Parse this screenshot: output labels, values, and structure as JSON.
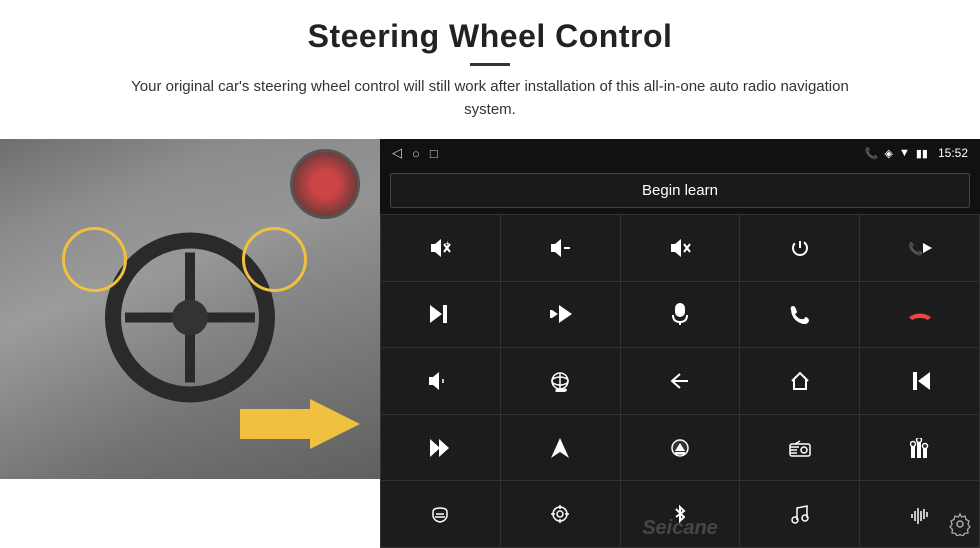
{
  "header": {
    "title": "Steering Wheel Control",
    "divider": true,
    "subtitle": "Your original car's steering wheel control will still work after installation of this all-in-one auto radio navigation system."
  },
  "status_bar": {
    "time": "15:52",
    "icons": [
      "phone",
      "location",
      "wifi",
      "battery"
    ]
  },
  "begin_learn": {
    "label": "Begin learn"
  },
  "grid_icons": [
    "🔊+",
    "🔊−",
    "🔇",
    "⏻",
    "📞⏭",
    "⏭",
    "⏭✂",
    "🎤",
    "📞",
    "↩",
    "🔈",
    "360°",
    "↺",
    "🏠",
    "⏮⏮",
    "⏭⏭",
    "▶",
    "⏏",
    "📻",
    "🎚",
    "🎤",
    "⊙",
    "✱",
    "🎵",
    "📊"
  ],
  "watermark": "Seicane",
  "nav_icons": [
    "◁",
    "○",
    "□"
  ],
  "colors": {
    "background": "#ffffff",
    "screen_bg": "#111111",
    "grid_bg": "#1c1c1c",
    "grid_border": "#333333",
    "accent": "#f0c040"
  }
}
